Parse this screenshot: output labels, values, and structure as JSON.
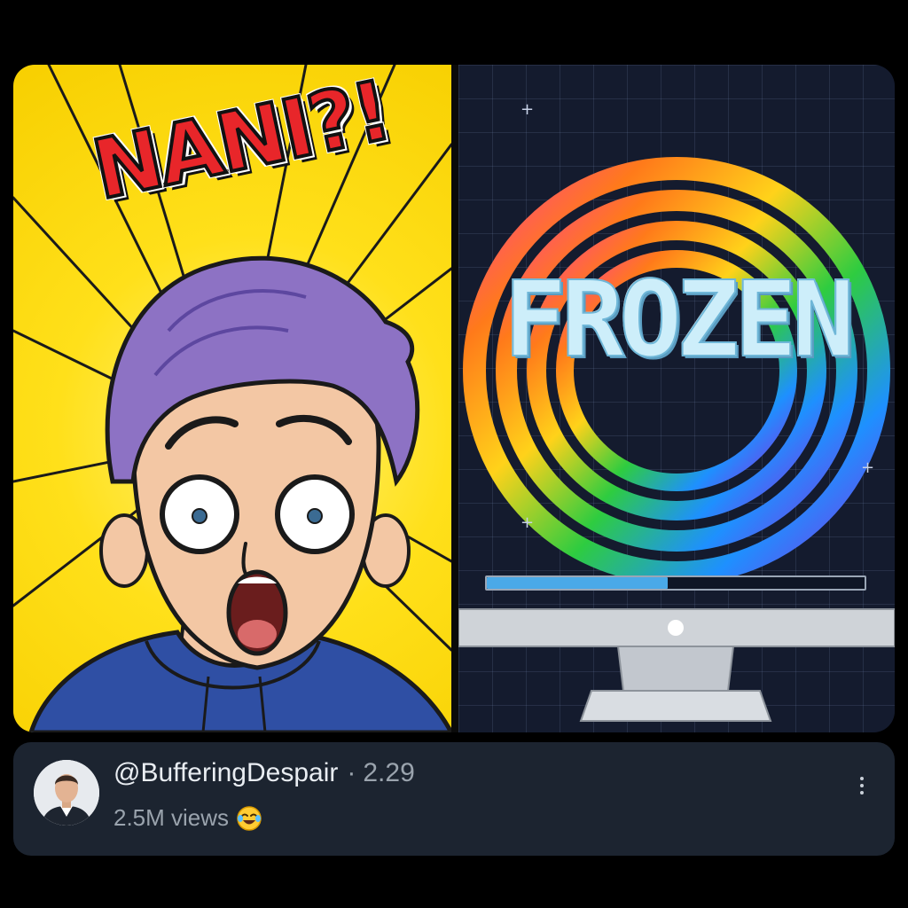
{
  "post": {
    "left_panel": {
      "headline": "NANI?!"
    },
    "right_panel": {
      "headline": "FROZEN",
      "loading_progress": 0.48
    }
  },
  "channel": {
    "handle": "@BufferingDespair",
    "separator": "·",
    "time": "2.29",
    "views": "2.5M views",
    "reaction_icon": "tears-of-joy-emoji-icon"
  },
  "colors": {
    "left_background": "#ffe01a",
    "headline_red": "#e8262a",
    "hair_purple": "#8d72c4",
    "hoodie_blue": "#2f4fa4",
    "right_background": "#141b2e",
    "frozen_text": "#cdeefa",
    "progress_fill": "#4aa9e8",
    "info_bar_bg": "#1c2430"
  }
}
